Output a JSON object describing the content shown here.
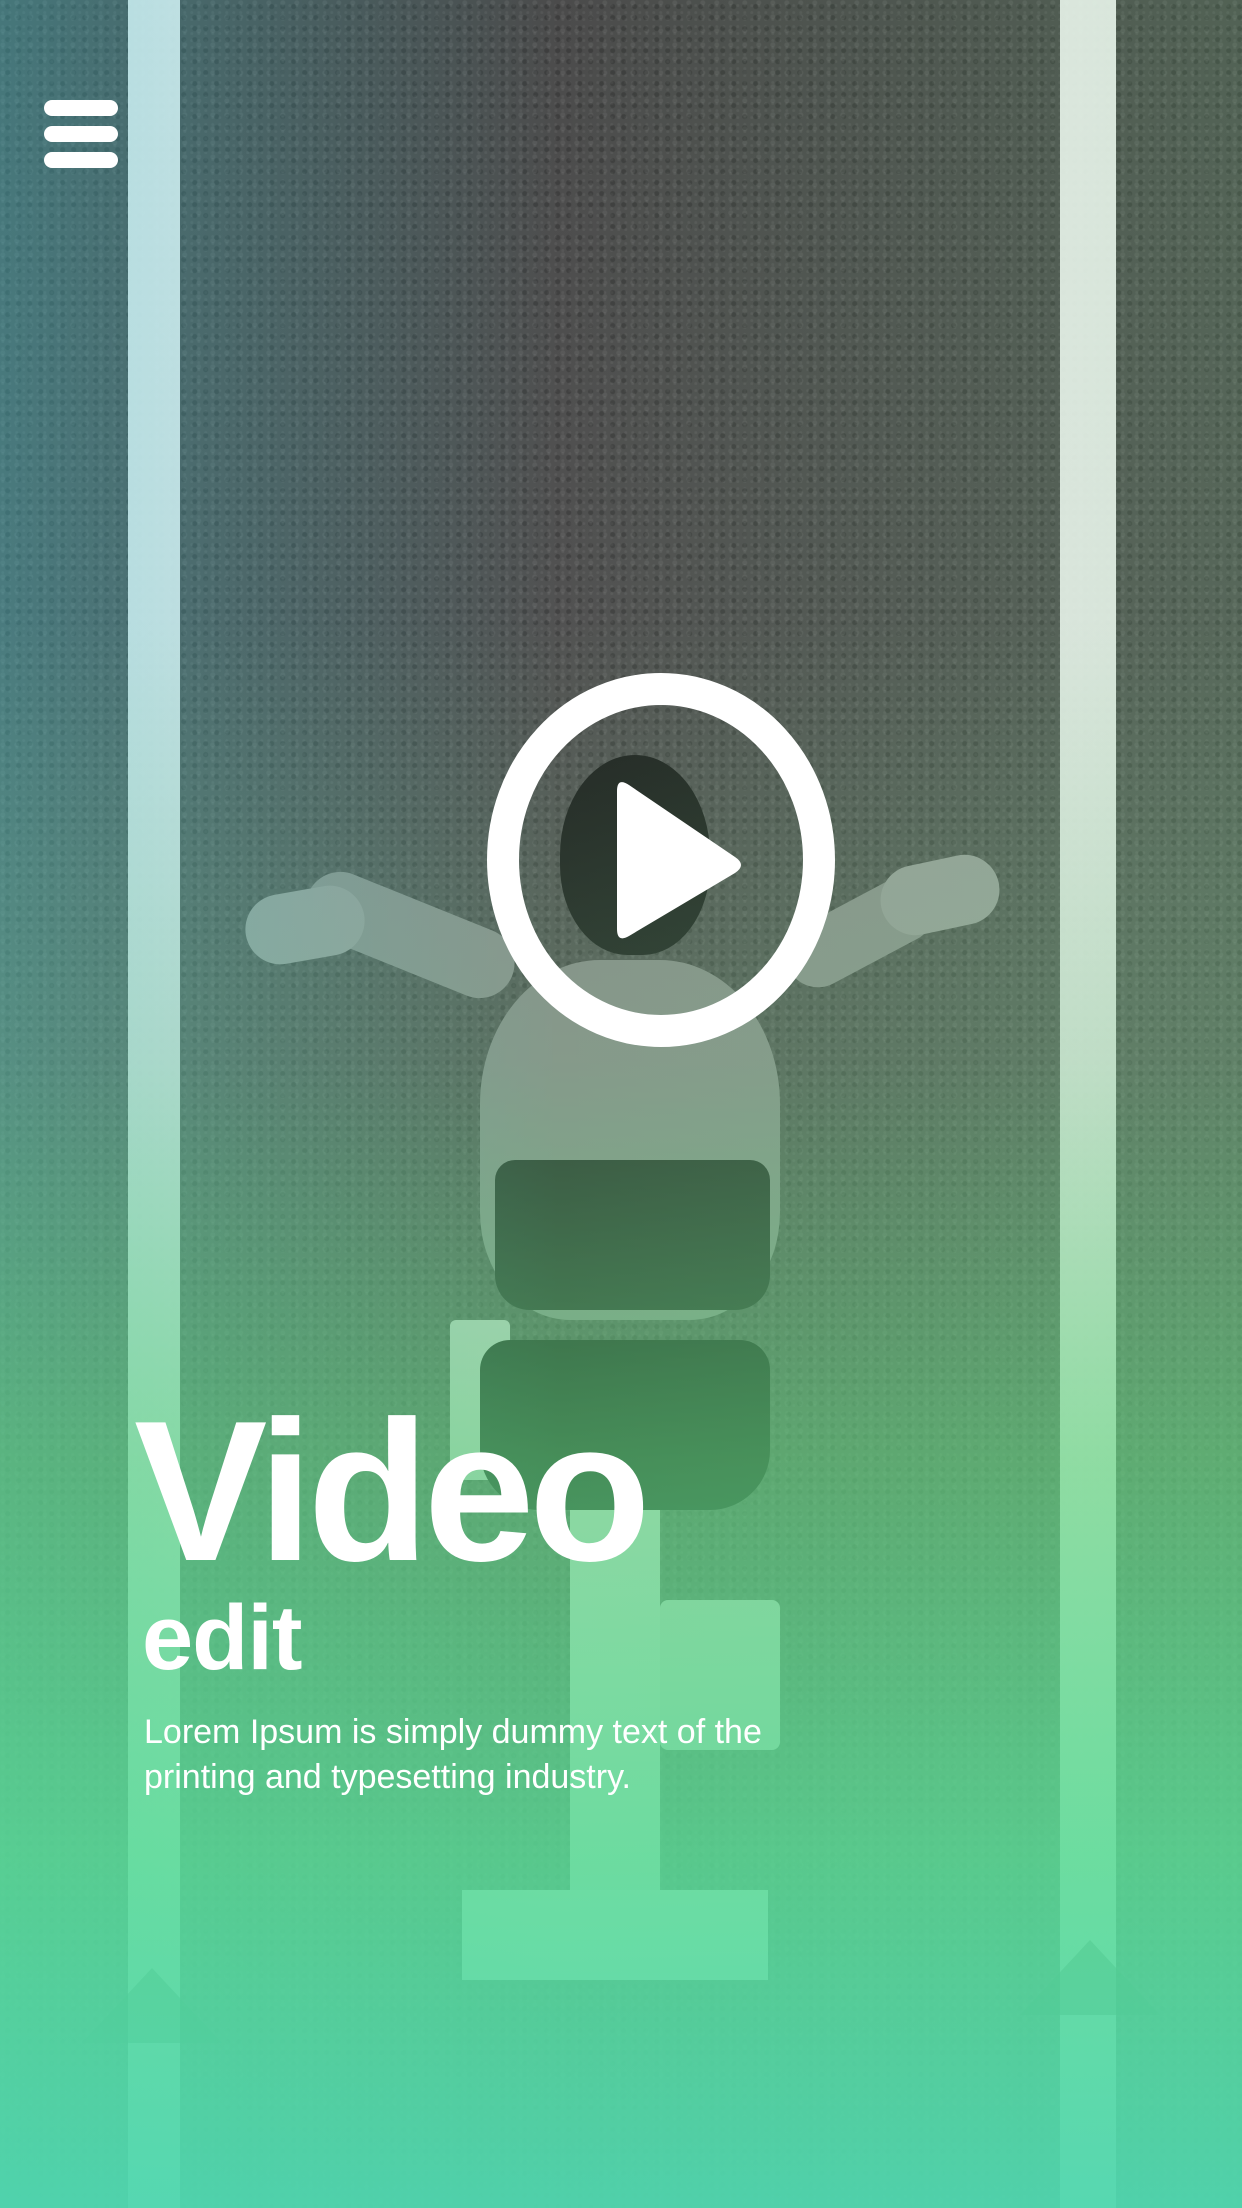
{
  "header": {
    "menu_icon": "hamburger-menu-icon"
  },
  "player": {
    "play_icon": "play-icon",
    "accent_color": "#ffffff"
  },
  "hero": {
    "title": "Video",
    "subtitle": "edit",
    "description": "Lorem Ipsum is simply dummy text of the printing and typesetting industry."
  },
  "theme": {
    "gradient_top": "#5a5a5a",
    "gradient_mid": "#64d782",
    "gradient_bottom": "#50d7af"
  }
}
